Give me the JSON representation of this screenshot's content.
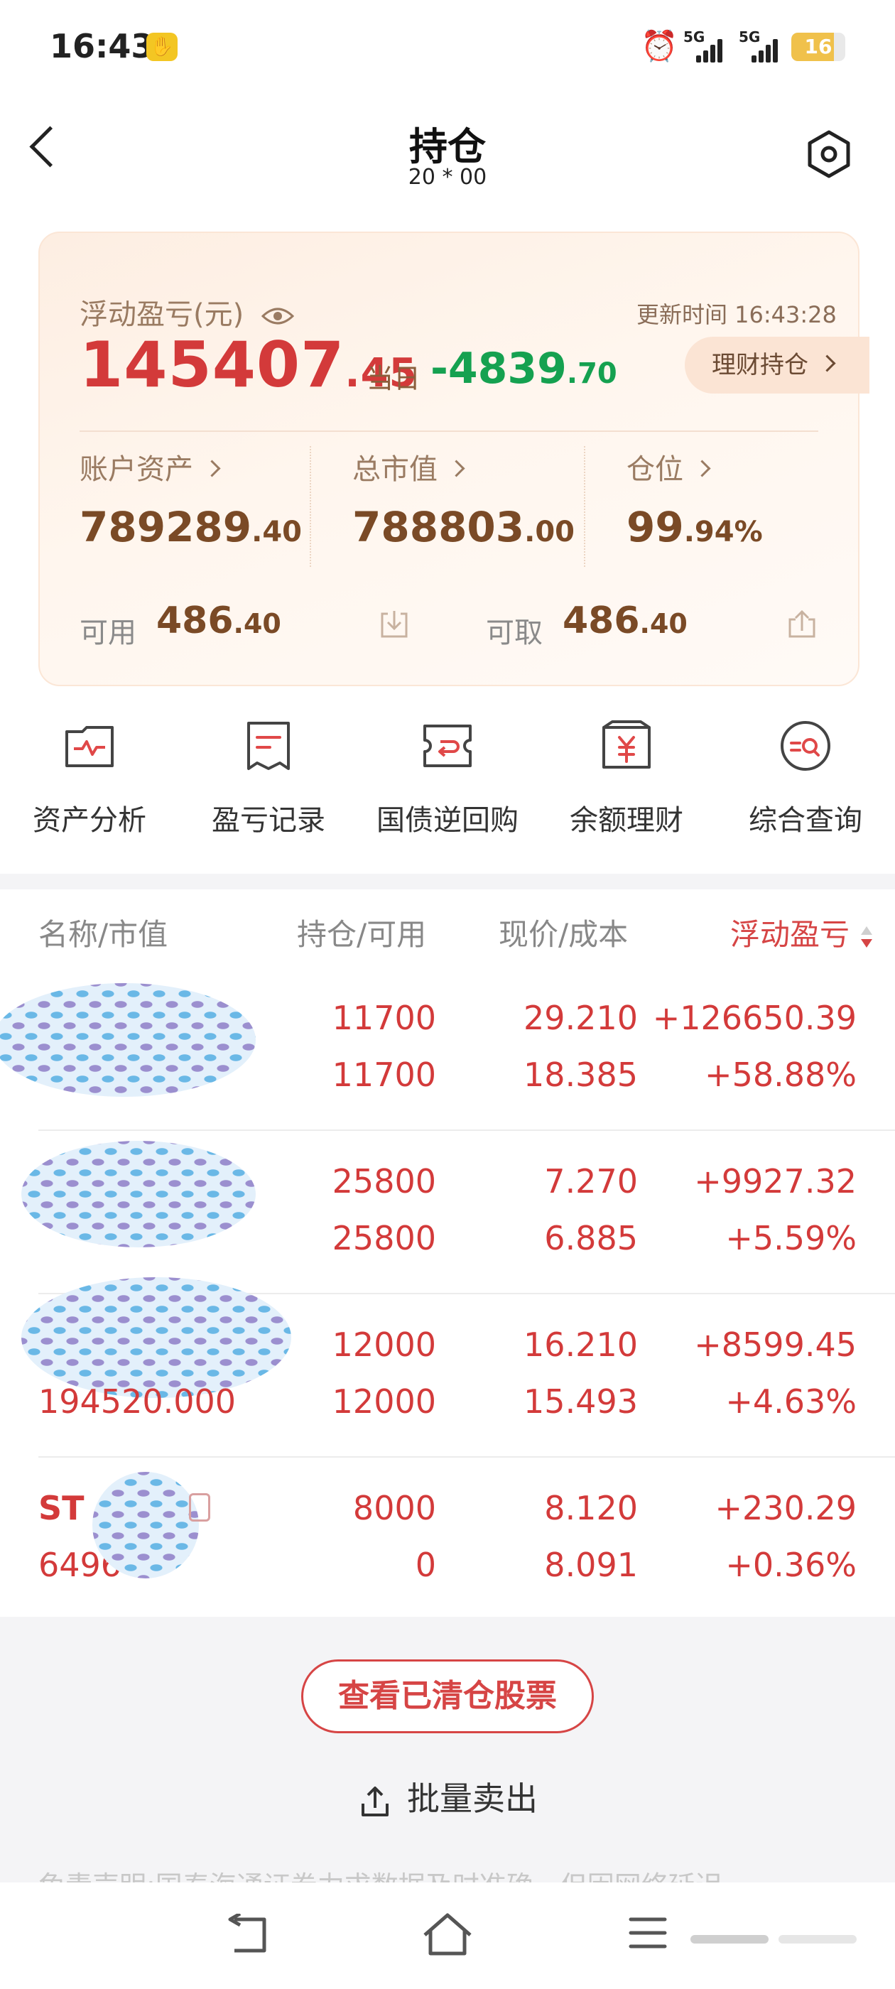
{
  "status_bar": {
    "time": "16:43",
    "net1": "5G",
    "net2": "5G",
    "battery": "16"
  },
  "header": {
    "title": "持仓",
    "account": "20 * 00"
  },
  "summary": {
    "float_label": "浮动盈亏(元)",
    "float_int": "145407",
    "float_dec": ".45",
    "update_time": "更新时间 16:43:28",
    "today_label": "当日",
    "today_int": "-4839",
    "today_dec": ".70",
    "wealth_button": "理财持仓",
    "account_assets_label": "账户资产",
    "account_assets_int": "789289",
    "account_assets_dec": ".40",
    "market_value_label": "总市值",
    "market_value_int": "788803",
    "market_value_dec": ".00",
    "position_label": "仓位",
    "position_int": "99",
    "position_dec": ".94%",
    "available_label": "可用",
    "available_int": "486",
    "available_dec": ".40",
    "withdrawable_label": "可取",
    "withdrawable_int": "486",
    "withdrawable_dec": ".40"
  },
  "shortcuts": [
    {
      "label": "资产分析",
      "icon": "asset-analysis-icon"
    },
    {
      "label": "盈亏记录",
      "icon": "pnl-record-icon"
    },
    {
      "label": "国债逆回购",
      "icon": "reverse-repo-icon"
    },
    {
      "label": "余额理财",
      "icon": "balance-wealth-icon"
    },
    {
      "label": "综合查询",
      "icon": "query-icon"
    }
  ],
  "table": {
    "headers": [
      "名称/市值",
      "持仓/可用",
      "现价/成本",
      "浮动盈亏"
    ],
    "rows": [
      {
        "name": "",
        "market_value": "",
        "hold": "11700",
        "avail": "11700",
        "price": "29.210",
        "cost": "18.385",
        "pnl": "+126650.39",
        "pnl_pct": "+58.88%"
      },
      {
        "name": "",
        "market_value": "",
        "hold": "25800",
        "avail": "25800",
        "price": "7.270",
        "cost": "6.885",
        "pnl": "+9927.32",
        "pnl_pct": "+5.59%"
      },
      {
        "name": "",
        "market_value": "194520.000",
        "hold": "12000",
        "avail": "12000",
        "price": "16.210",
        "cost": "15.493",
        "pnl": "+8599.45",
        "pnl_pct": "+4.63%"
      },
      {
        "name": "ST",
        "market_value": "6496",
        "hold": "8000",
        "avail": "0",
        "price": "8.120",
        "cost": "8.091",
        "pnl": "+230.29",
        "pnl_pct": "+0.36%"
      }
    ]
  },
  "actions": {
    "view_cleared": "查看已清仓股票",
    "batch_sell": "批量卖出"
  },
  "disclaimer": "免责声明:国泰海通证券力求数据及时准确，但因网络延迟"
}
